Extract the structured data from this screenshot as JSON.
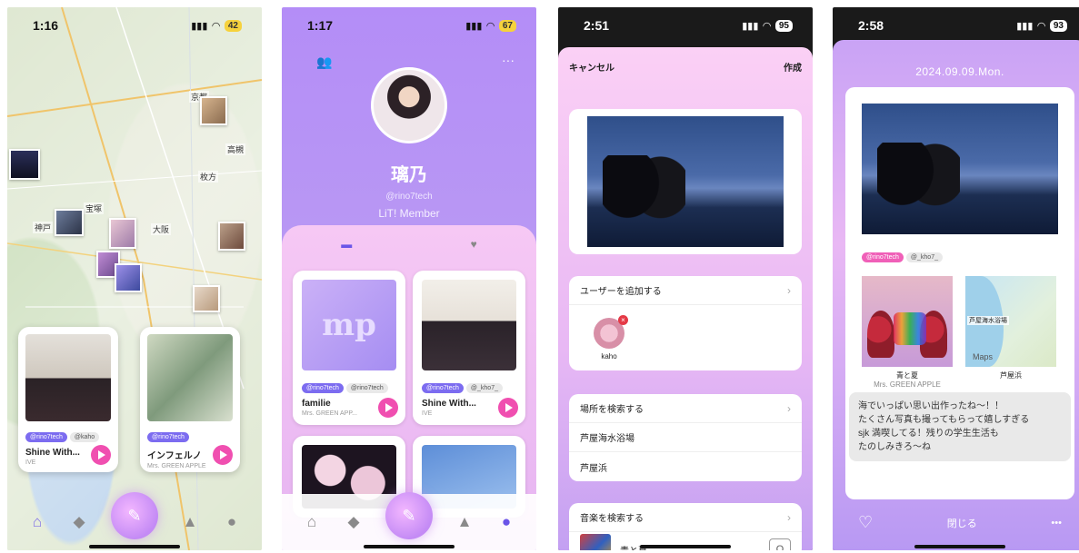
{
  "phone1": {
    "status": {
      "time": "1:16",
      "battery": "42"
    },
    "map_labels": [
      "京都",
      "大阪",
      "枚方",
      "神戸",
      "高槻",
      "宝塚"
    ],
    "cards": [
      {
        "tags": [
          "@rino7tech",
          "@kaho"
        ],
        "song": "Shine With...",
        "artist": "IVE"
      },
      {
        "tags": [
          "@rino7tech"
        ],
        "song": "インフェルノ",
        "artist": "Mrs. GREEN APPLE"
      }
    ],
    "tabs": [
      "home-icon",
      "tag-icon",
      "compose-icon",
      "bell-icon",
      "profile-icon"
    ]
  },
  "phone2": {
    "status": {
      "time": "1:17",
      "battery": "67"
    },
    "name": "璃乃",
    "handle": "@rino7tech",
    "member": "LiT! Member",
    "more": "···",
    "cards": [
      {
        "logo": "mp",
        "tags": [
          "@rino7tech",
          "@rino7tech"
        ],
        "song": "familie",
        "artist": "Mrs. GREEN APP..."
      },
      {
        "tags": [
          "@rino7tech",
          "@_kho7_"
        ],
        "song": "Shine With...",
        "artist": "IVE"
      }
    ]
  },
  "phone3": {
    "status": {
      "time": "2:51",
      "battery": "95"
    },
    "cancel": "キャンセル",
    "create": "作成",
    "add_user": "ユーザーを追加する",
    "user_name": "kaho",
    "search_place": "場所を検索する",
    "places": [
      "芦屋海水浴場",
      "芦屋浜"
    ],
    "search_music": "音楽を検索する",
    "music_result": "青と夏"
  },
  "phone4": {
    "status": {
      "time": "2:58",
      "battery": "93"
    },
    "date": "2024.09.09.Mon.",
    "tags": [
      "@rino7tech",
      "@_kho7_"
    ],
    "song": "青と夏",
    "artist": "Mrs. GREEN APPLE",
    "place": "芦屋浜",
    "map_place": "芦屋海水浴場",
    "map_brand": "Maps",
    "memo": "海でいっぱい思い出作ったね〜！！\nたくさん写真も撮ってもらって嬉しすぎる\nsjk 満喫してる！残りの学生生活も\nたのしみきろ〜ね",
    "close": "閉じる",
    "more": "•••"
  },
  "colors": {
    "accent_pink": "#f04fb0",
    "accent_purple": "#7c6cf0",
    "lavender": "#b48df7"
  }
}
